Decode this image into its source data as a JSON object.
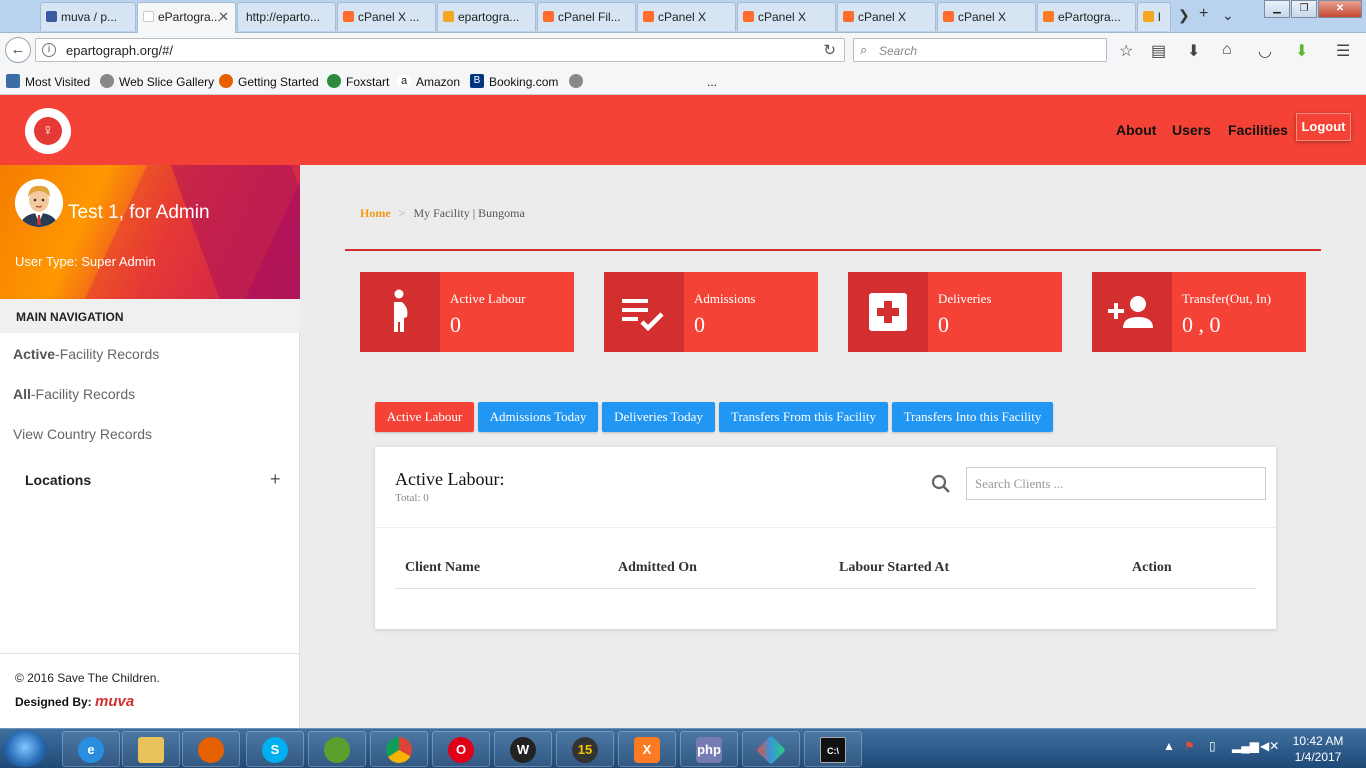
{
  "browser": {
    "tabs": [
      {
        "label": "muva / p...",
        "color": "#3a5ba0"
      },
      {
        "label": "ePartogra...",
        "color": "#ffffff",
        "active": true
      },
      {
        "label": "http://eparto...",
        "color": "#ffffff"
      },
      {
        "label": "cPanel X ...",
        "color": "#ff6c2c"
      },
      {
        "label": "epartogra...",
        "color": "#f5a623"
      },
      {
        "label": "cPanel Fil...",
        "color": "#ff6c2c"
      },
      {
        "label": "cPanel X",
        "color": "#ff6c2c"
      },
      {
        "label": "cPanel X",
        "color": "#ff6c2c"
      },
      {
        "label": "cPanel X",
        "color": "#ff6c2c"
      },
      {
        "label": "cPanel X",
        "color": "#ff6c2c"
      },
      {
        "label": "ePartogra...",
        "color": "#fb7a24"
      },
      {
        "label": "l",
        "color": "#f5a623"
      }
    ],
    "url": "epartograph.org/#/",
    "search_placeholder": "Search",
    "bookmarks": [
      {
        "label": "Most Visited",
        "color": "#3a6ea5"
      },
      {
        "label": "Web Slice Gallery",
        "color": "#888888"
      },
      {
        "label": "Getting Started",
        "color": "#e66000"
      },
      {
        "label": "Foxstart",
        "color": "#2c8c3c"
      },
      {
        "label": "Amazon",
        "color": "#222222"
      },
      {
        "label": "Booking.com",
        "color": "#003580"
      }
    ],
    "bookmarks_overflow": "..."
  },
  "header": {
    "nav": [
      "About",
      "Users",
      "Facilities"
    ],
    "logout": "Logout"
  },
  "sidebar": {
    "profile_name": "Test 1, for Admin",
    "user_type": "User Type: Super Admin",
    "nav_header": "MAIN NAVIGATION",
    "items": [
      {
        "bold": "Active",
        "rest": "-Facility Records"
      },
      {
        "bold": "All",
        "rest": "-Facility Records"
      },
      {
        "bold": "",
        "rest": "View Country Records"
      }
    ],
    "locations": "Locations",
    "copyright": "© 2016 Save The Children.",
    "designed_by": "Designed By:",
    "designer_logo": "muva"
  },
  "breadcrumb": {
    "home": "Home",
    "current": "My Facility | Bungoma"
  },
  "stats": [
    {
      "label": "Active Labour",
      "value": "0",
      "icon": "pregnant-woman-icon"
    },
    {
      "label": "Admissions",
      "value": "0",
      "icon": "playlist-check-icon"
    },
    {
      "label": "Deliveries",
      "value": "0",
      "icon": "medical-cross-icon"
    },
    {
      "label": "Transfer(Out, In)",
      "value": "0 , 0",
      "icon": "person-add-icon"
    }
  ],
  "tabs": [
    {
      "label": "Active Labour",
      "active": true
    },
    {
      "label": "Admissions Today"
    },
    {
      "label": "Deliveries Today"
    },
    {
      "label": "Transfers From this Facility"
    },
    {
      "label": "Transfers Into this Facility"
    }
  ],
  "table_card": {
    "title": "Active Labour:",
    "total": "Total: 0",
    "search_placeholder": "Search Clients ...",
    "columns": [
      "Client Name",
      "Admitted On",
      "Labour Started At",
      "Action"
    ],
    "rows": []
  },
  "taskbar": {
    "apps": [
      "internet-explorer",
      "file-explorer",
      "firefox",
      "skype",
      "network-tool",
      "chrome",
      "opera",
      "wamp",
      "app-15",
      "xampp",
      "php",
      "app-diamond",
      "command-prompt"
    ],
    "clock_time": "10:42 AM",
    "clock_date": "1/4/2017"
  },
  "colors": {
    "primary_red": "#f44336",
    "dark_red": "#d32f2f",
    "tab_blue": "#2196f3",
    "breadcrumb_orange": "#f39c12"
  }
}
